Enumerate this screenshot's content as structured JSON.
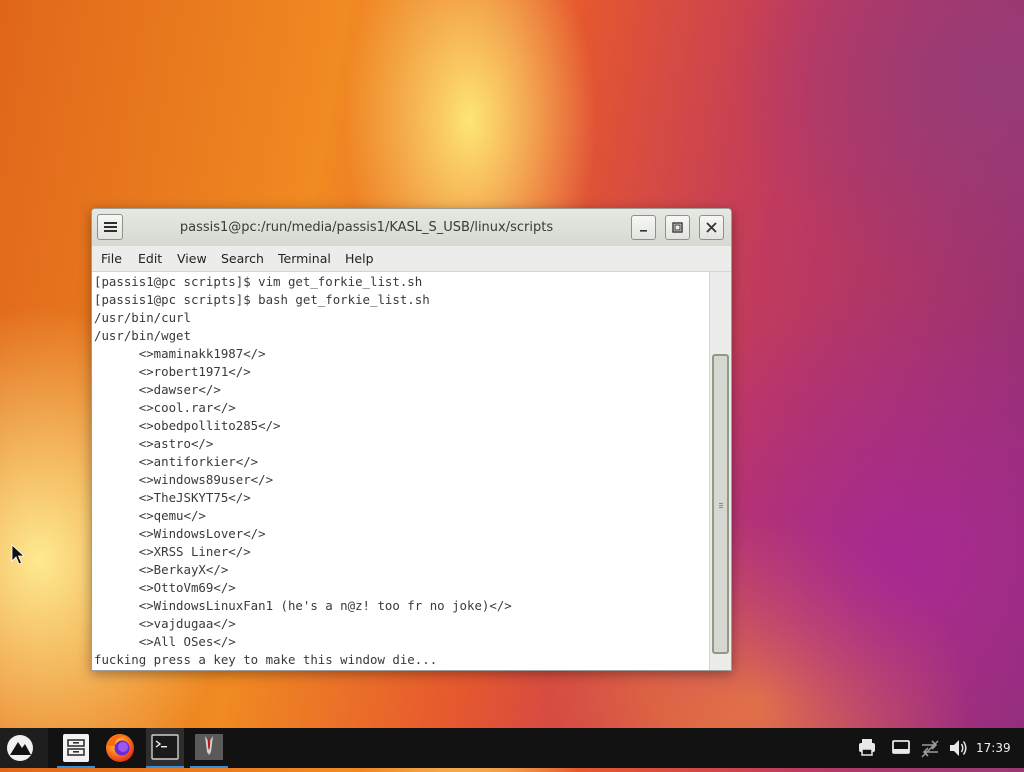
{
  "window": {
    "title": "passis1@pc:/run/media/passis1/KASL_S_USB/linux/scripts",
    "menu": [
      "File",
      "Edit",
      "View",
      "Search",
      "Terminal",
      "Help"
    ],
    "buttons": [
      "minimize",
      "maximize",
      "close"
    ]
  },
  "terminal": {
    "lines": [
      "[passis1@pc scripts]$ vim get_forkie_list.sh",
      "[passis1@pc scripts]$ bash get_forkie_list.sh",
      "/usr/bin/curl",
      "/usr/bin/wget",
      "      <>maminakk1987</>",
      "      <>robert1971</>",
      "      <>dawser</>",
      "      <>cool.rar</>",
      "      <>obedpollito285</>",
      "      <>astro</>",
      "      <>antiforkier</>",
      "      <>windows89user</>",
      "      <>TheJSKYT75</>",
      "      <>qemu</>",
      "      <>WindowsLover</>",
      "      <>XRSS Liner</>",
      "      <>BerkayX</>",
      "      <>OttoVm69</>",
      "      <>WindowsLinuxFan1 (he's a n@z! too fr no joke)</>",
      "      <>vajdugaa</>",
      "      <>All OSes</>",
      "fucking press a key to make this window die..."
    ]
  },
  "taskbar": {
    "clock": "17:39",
    "icons": [
      "start-menu-icon",
      "file-manager-icon",
      "firefox-icon",
      "terminal-app-icon",
      "vm-app-icon",
      "printer-icon",
      "display-icon",
      "network-icon",
      "volume-icon"
    ]
  },
  "colors": {
    "terminal_text": "#3a3a3a",
    "taskbar_bg": "#121212",
    "titlebar": "#dcdfd8"
  }
}
